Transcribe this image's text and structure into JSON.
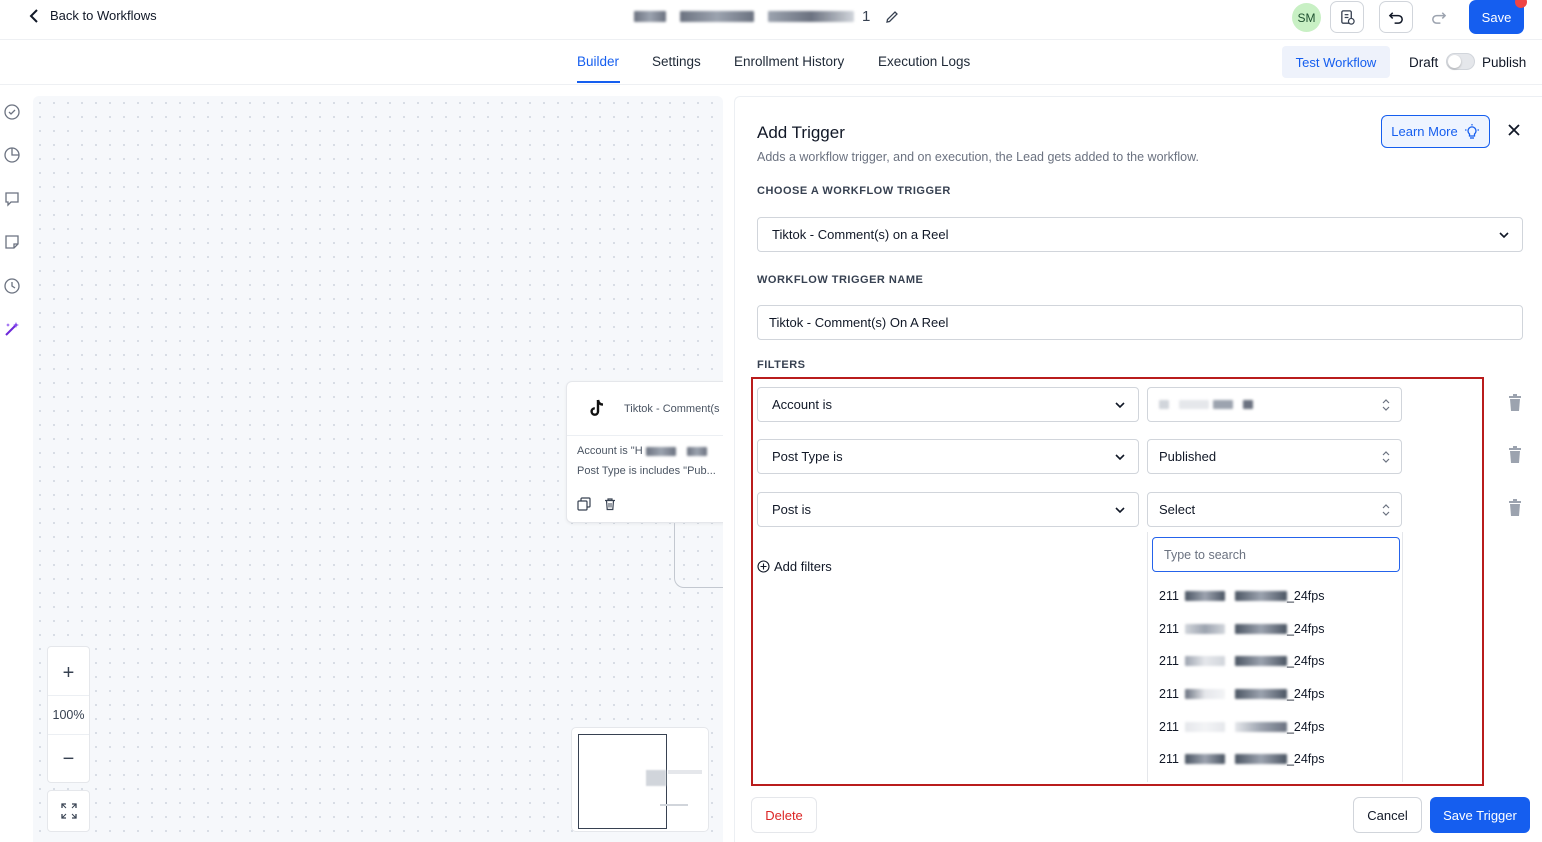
{
  "header": {
    "back_label": "Back to Workflows",
    "workflow_name_suffix": "1",
    "avatar_initials": "SM",
    "save_label": "Save"
  },
  "tabs": [
    {
      "label": "Builder",
      "active": true
    },
    {
      "label": "Settings",
      "active": false
    },
    {
      "label": "Enrollment History",
      "active": false
    },
    {
      "label": "Execution Logs",
      "active": false
    }
  ],
  "actions": {
    "test_workflow_label": "Test Workflow",
    "draft_label": "Draft",
    "publish_label": "Publish",
    "published": false
  },
  "left_rail": {
    "icons": [
      "check-circle-icon",
      "pie-chart-icon",
      "comment-icon",
      "note-icon",
      "clock-icon",
      "magic-wand-icon"
    ]
  },
  "canvas": {
    "node": {
      "title": "Tiktok - Comment(s",
      "line1": "Account is \"H",
      "line2": "Post Type is includes \"Pub..."
    },
    "zoom_level": "100%",
    "zoom_in": "+",
    "zoom_out": "−"
  },
  "panel": {
    "title": "Add Trigger",
    "description": "Adds a workflow trigger, and on execution, the Lead gets added to the workflow.",
    "learn_more_label": "Learn More",
    "choose_trigger_label": "CHOOSE A WORKFLOW TRIGGER",
    "trigger_value": "Tiktok - Comment(s) on a Reel",
    "trigger_name_label": "WORKFLOW TRIGGER NAME",
    "trigger_name_value": "Tiktok - Comment(s) On A Reel",
    "filters_label": "FILTERS",
    "filters": [
      {
        "field": "Account is",
        "value": ""
      },
      {
        "field": "Post Type is",
        "value": "Published"
      },
      {
        "field": "Post is",
        "value": "Select"
      }
    ],
    "add_filters_label": "Add filters",
    "dropdown": {
      "search_placeholder": "Type to search",
      "option_prefix": "211",
      "option_suffix": "_24fps"
    },
    "delete_label": "Delete",
    "cancel_label": "Cancel",
    "save_trigger_label": "Save Trigger"
  },
  "colors": {
    "primary": "#155eef",
    "danger": "#dc2626",
    "highlight_frame": "#b91c1c",
    "avatar_bg": "#c8f0c4"
  }
}
